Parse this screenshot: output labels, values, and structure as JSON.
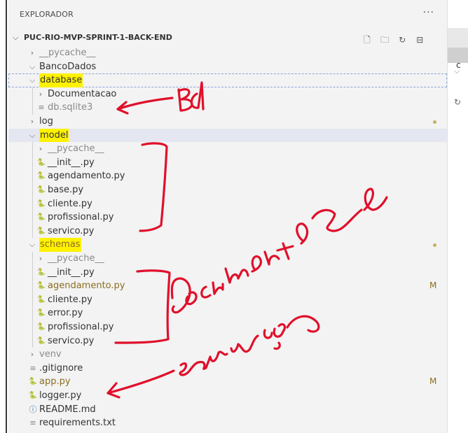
{
  "explorer": {
    "title": "EXPLORADOR",
    "more_label": "···",
    "section": {
      "name": "PUC-RIO-MVP-SPRINT-1-BACK-END",
      "actions": [
        "new-file-icon",
        "new-folder-icon",
        "refresh-icon",
        "collapse-all-icon"
      ]
    },
    "tree": [
      {
        "label": "__pycache__",
        "depth": 1,
        "kind": "folder",
        "expanded": false,
        "dim": true
      },
      {
        "label": "BancoDados",
        "depth": 1,
        "kind": "folder",
        "expanded": true
      },
      {
        "label": "database",
        "depth": 1,
        "kind": "folder",
        "expanded": true,
        "highlight": true
      },
      {
        "label": "Documentacao",
        "depth": 2,
        "kind": "folder",
        "expanded": false
      },
      {
        "label": "db.sqlite3",
        "depth": 2,
        "kind": "text",
        "dim": true
      },
      {
        "label": "log",
        "depth": 1,
        "kind": "folder",
        "expanded": false,
        "dot": true
      },
      {
        "label": "model",
        "depth": 1,
        "kind": "folder",
        "expanded": true,
        "highlight": true,
        "selected": true
      },
      {
        "label": "__pycache__",
        "depth": 2,
        "kind": "folder",
        "expanded": false,
        "dim": true
      },
      {
        "label": "__init__.py",
        "depth": 2,
        "kind": "python"
      },
      {
        "label": "agendamento.py",
        "depth": 2,
        "kind": "python"
      },
      {
        "label": "base.py",
        "depth": 2,
        "kind": "python"
      },
      {
        "label": "cliente.py",
        "depth": 2,
        "kind": "python"
      },
      {
        "label": "profissional.py",
        "depth": 2,
        "kind": "python"
      },
      {
        "label": "servico.py",
        "depth": 2,
        "kind": "python"
      },
      {
        "label": "schemas",
        "depth": 1,
        "kind": "folder",
        "expanded": true,
        "highlight": true,
        "modified": true,
        "dot": true
      },
      {
        "label": "__pycache__",
        "depth": 2,
        "kind": "folder",
        "expanded": false,
        "dim": true
      },
      {
        "label": "__init__.py",
        "depth": 2,
        "kind": "python"
      },
      {
        "label": "agendamento.py",
        "depth": 2,
        "kind": "python",
        "modified": true,
        "badge": "M"
      },
      {
        "label": "cliente.py",
        "depth": 2,
        "kind": "python"
      },
      {
        "label": "error.py",
        "depth": 2,
        "kind": "python"
      },
      {
        "label": "profissional.py",
        "depth": 2,
        "kind": "python"
      },
      {
        "label": "servico.py",
        "depth": 2,
        "kind": "python"
      },
      {
        "label": "venv",
        "depth": 1,
        "kind": "folder",
        "expanded": false,
        "dim": true
      },
      {
        "label": ".gitignore",
        "depth": 1,
        "kind": "text"
      },
      {
        "label": "app.py",
        "depth": 1,
        "kind": "python",
        "modified": true,
        "badge": "M"
      },
      {
        "label": "logger.py",
        "depth": 1,
        "kind": "python"
      },
      {
        "label": "README.md",
        "depth": 1,
        "kind": "info"
      },
      {
        "label": "requirements.txt",
        "depth": 1,
        "kind": "text"
      }
    ]
  },
  "editor_tab": {
    "label": "c"
  },
  "annotations": [
    {
      "text": "Bd",
      "target": "database"
    },
    {
      "text": "Documentos",
      "target": "model"
    },
    {
      "text": "serviço",
      "target": "schemas"
    }
  ],
  "colors": {
    "highlight": "#fff200",
    "ink": "#e0102b",
    "modified": "#8c6d1f",
    "python": "#3572A5",
    "selection": "#e4e6f1"
  }
}
